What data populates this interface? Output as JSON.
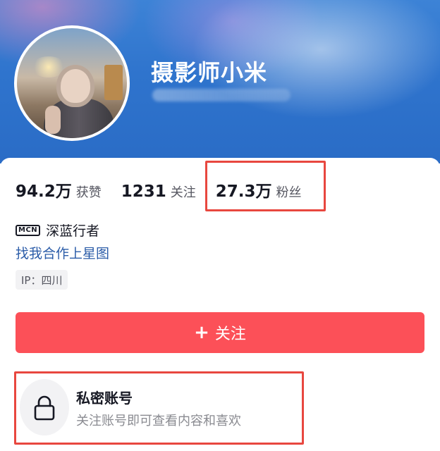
{
  "profile": {
    "username": "摄影师小米"
  },
  "stats": [
    {
      "value": "94.2万",
      "label": "获赞"
    },
    {
      "value": "1231",
      "label": "关注"
    },
    {
      "value": "27.3万",
      "label": "粉丝"
    }
  ],
  "mcn": {
    "badge": "MCN",
    "name": "深蓝行者"
  },
  "star_link": "找我合作上星图",
  "ip_tag": "IP：四川",
  "follow_button": {
    "plus": "+",
    "label": "关注"
  },
  "private_account": {
    "title": "私密账号",
    "description": "关注账号即可查看内容和喜欢"
  },
  "colors": {
    "header_blue": "#2f74cd",
    "follow_red": "#fc5058",
    "highlight_red": "#e8473f",
    "link_blue": "#2b5ca8"
  },
  "icons": [
    "lock-icon"
  ]
}
